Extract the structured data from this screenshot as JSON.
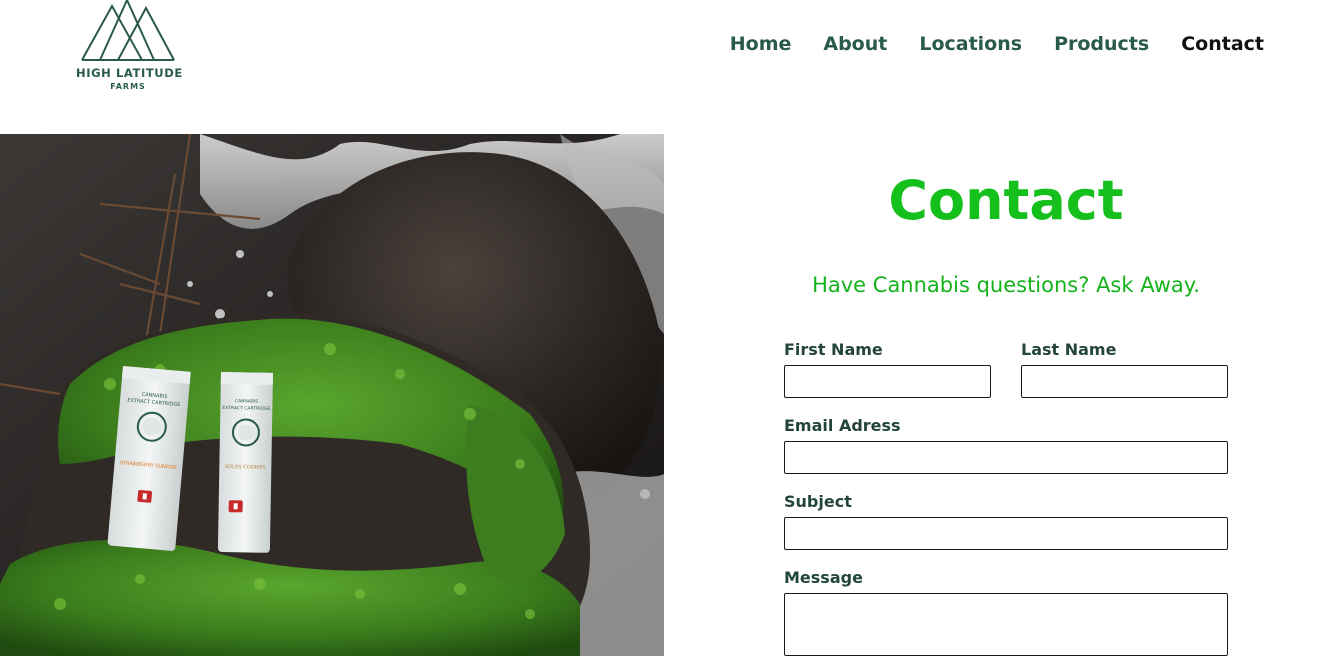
{
  "brand": {
    "name": "HIGH LATITUDE",
    "sub": "FARMS",
    "color": "#2a5a48"
  },
  "nav": {
    "items": [
      {
        "label": "Home",
        "active": false
      },
      {
        "label": "About",
        "active": false
      },
      {
        "label": "Locations",
        "active": false
      },
      {
        "label": "Products",
        "active": false
      },
      {
        "label": "Contact",
        "active": true
      }
    ]
  },
  "hero": {
    "icon": "product-photo",
    "box_left": {
      "line1": "CANNABIS",
      "line2": "EXTRACT CARTRIDGE",
      "flavor": "STRAWBERRY SUNRISE"
    },
    "box_right": {
      "line1": "CANNABIS",
      "line2": "EXTRACT CARTRIDGE",
      "flavor": "SOLOS COOKIES"
    }
  },
  "contact": {
    "title": "Contact",
    "subtitle": "Have Cannabis questions? Ask Away.",
    "title_color": "#15c01d",
    "fields": {
      "first_name": {
        "label": "First Name",
        "value": ""
      },
      "last_name": {
        "label": "Last Name",
        "value": ""
      },
      "email": {
        "label": "Email Adress",
        "value": ""
      },
      "subject": {
        "label": "Subject",
        "value": ""
      },
      "message": {
        "label": "Message",
        "value": ""
      }
    }
  }
}
